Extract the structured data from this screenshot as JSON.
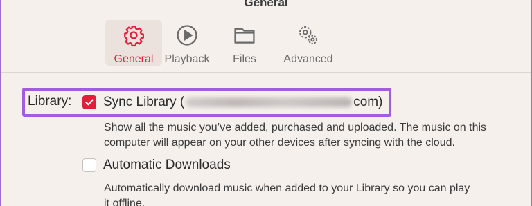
{
  "window": {
    "title": "General"
  },
  "tabs": [
    {
      "label": "General",
      "icon": "gear-icon",
      "active": true
    },
    {
      "label": "Playback",
      "icon": "play-circle-icon",
      "active": false
    },
    {
      "label": "Files",
      "icon": "folder-icon",
      "active": false
    },
    {
      "label": "Advanced",
      "icon": "gears-icon",
      "active": false
    }
  ],
  "library": {
    "label": "Library:",
    "sync_label": "Sync Library (",
    "email_suffix": "com)",
    "sync_checked": true,
    "sync_description_line1": "Show all the music you’ve added, purchased and uploaded. The music on this",
    "sync_description_line2": "computer will appear on your other devices after syncing with the cloud.",
    "auto_label": "Automatic Downloads",
    "auto_checked": false,
    "auto_description_line1": "Automatically download music when added to your Library so you can play",
    "auto_description_line2": "it offline."
  },
  "colors": {
    "accent": "#e0203a",
    "highlight": "#a35be2",
    "background": "#f6f0ec"
  }
}
